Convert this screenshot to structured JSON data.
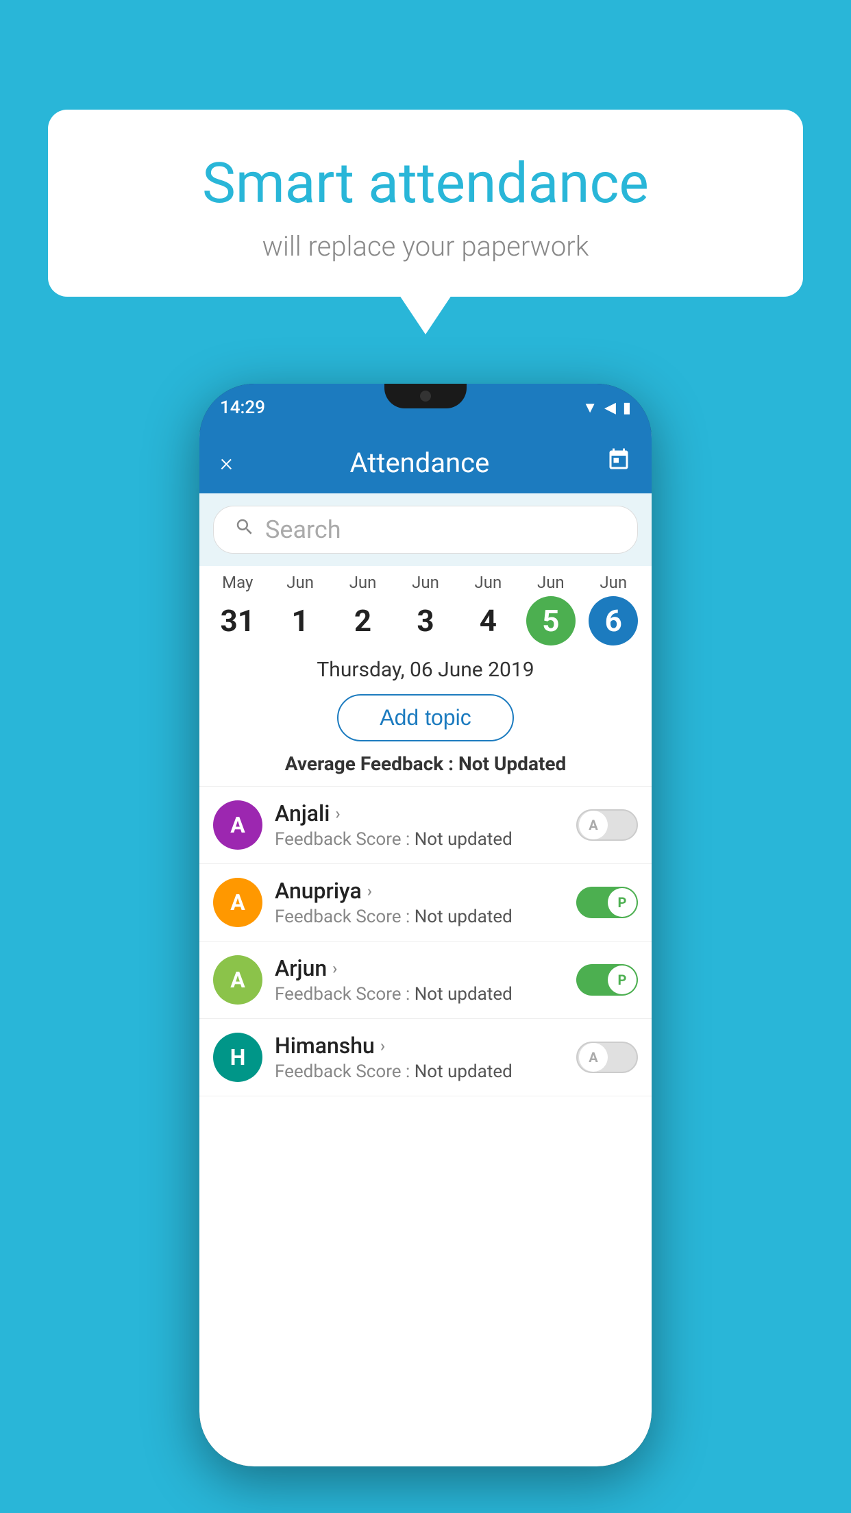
{
  "background_color": "#29b6d8",
  "bubble": {
    "title": "Smart attendance",
    "subtitle": "will replace your paperwork"
  },
  "phone": {
    "status_bar": {
      "time": "14:29"
    },
    "header": {
      "title": "Attendance",
      "close_label": "×",
      "calendar_icon": "calendar-icon"
    },
    "search": {
      "placeholder": "Search"
    },
    "calendar": {
      "columns": [
        {
          "month": "May",
          "day": "31",
          "state": "normal"
        },
        {
          "month": "Jun",
          "day": "1",
          "state": "normal"
        },
        {
          "month": "Jun",
          "day": "2",
          "state": "normal"
        },
        {
          "month": "Jun",
          "day": "3",
          "state": "normal"
        },
        {
          "month": "Jun",
          "day": "4",
          "state": "normal"
        },
        {
          "month": "Jun",
          "day": "5",
          "state": "today"
        },
        {
          "month": "Jun",
          "day": "6",
          "state": "selected"
        }
      ]
    },
    "selected_date": "Thursday, 06 June 2019",
    "add_topic_label": "Add topic",
    "avg_feedback_label": "Average Feedback :",
    "avg_feedback_value": "Not Updated",
    "students": [
      {
        "name": "Anjali",
        "avatar_letter": "A",
        "avatar_color": "purple",
        "feedback_label": "Feedback Score :",
        "feedback_value": "Not updated",
        "toggle_state": "off",
        "toggle_label": "A"
      },
      {
        "name": "Anupriya",
        "avatar_letter": "A",
        "avatar_color": "orange",
        "feedback_label": "Feedback Score :",
        "feedback_value": "Not updated",
        "toggle_state": "on",
        "toggle_label": "P"
      },
      {
        "name": "Arjun",
        "avatar_letter": "A",
        "avatar_color": "light-green",
        "feedback_label": "Feedback Score :",
        "feedback_value": "Not updated",
        "toggle_state": "on",
        "toggle_label": "P"
      },
      {
        "name": "Himanshu",
        "avatar_letter": "H",
        "avatar_color": "teal",
        "feedback_label": "Feedback Score :",
        "feedback_value": "Not updated",
        "toggle_state": "off",
        "toggle_label": "A"
      }
    ]
  }
}
